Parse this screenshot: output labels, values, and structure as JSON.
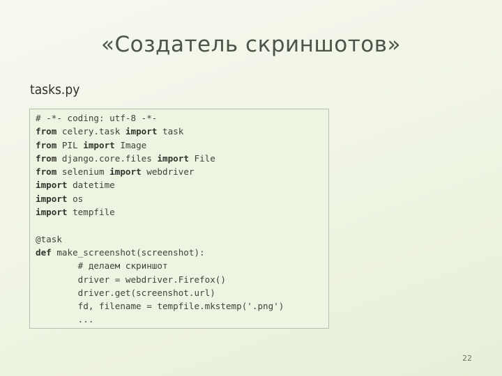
{
  "slide": {
    "title": "«Создатель скриншотов»",
    "file_name": "tasks.py",
    "page_number": "22"
  },
  "code": {
    "lines": [
      {
        "parts": [
          {
            "text": "# -*- coding: utf-8 -*-",
            "kw": false
          }
        ]
      },
      {
        "parts": [
          {
            "text": "from",
            "kw": true
          },
          {
            "text": " celery.task ",
            "kw": false
          },
          {
            "text": "import",
            "kw": true
          },
          {
            "text": " task",
            "kw": false
          }
        ]
      },
      {
        "parts": [
          {
            "text": "from",
            "kw": true
          },
          {
            "text": " PIL ",
            "kw": false
          },
          {
            "text": "import",
            "kw": true
          },
          {
            "text": " Image",
            "kw": false
          }
        ]
      },
      {
        "parts": [
          {
            "text": "from",
            "kw": true
          },
          {
            "text": " django.core.files ",
            "kw": false
          },
          {
            "text": "import",
            "kw": true
          },
          {
            "text": " File",
            "kw": false
          }
        ]
      },
      {
        "parts": [
          {
            "text": "from",
            "kw": true
          },
          {
            "text": " selenium ",
            "kw": false
          },
          {
            "text": "import",
            "kw": true
          },
          {
            "text": " webdriver",
            "kw": false
          }
        ]
      },
      {
        "parts": [
          {
            "text": "import",
            "kw": true
          },
          {
            "text": " datetime",
            "kw": false
          }
        ]
      },
      {
        "parts": [
          {
            "text": "import",
            "kw": true
          },
          {
            "text": " os",
            "kw": false
          }
        ]
      },
      {
        "parts": [
          {
            "text": "import",
            "kw": true
          },
          {
            "text": " tempfile",
            "kw": false
          }
        ]
      },
      {
        "parts": [
          {
            "text": "",
            "kw": false
          }
        ]
      },
      {
        "parts": [
          {
            "text": "@task",
            "kw": false
          }
        ]
      },
      {
        "parts": [
          {
            "text": "def",
            "kw": true
          },
          {
            "text": " make_screenshot(screenshot):",
            "kw": false
          }
        ]
      },
      {
        "parts": [
          {
            "text": "        # делаем скриншот",
            "kw": false
          }
        ]
      },
      {
        "parts": [
          {
            "text": "        driver = webdriver.Firefox()",
            "kw": false
          }
        ]
      },
      {
        "parts": [
          {
            "text": "        driver.get(screenshot.url)",
            "kw": false
          }
        ]
      },
      {
        "parts": [
          {
            "text": "        fd, filename = tempfile.mkstemp('.png')",
            "kw": false
          }
        ]
      },
      {
        "parts": [
          {
            "text": "        ...",
            "kw": false
          }
        ]
      }
    ]
  }
}
